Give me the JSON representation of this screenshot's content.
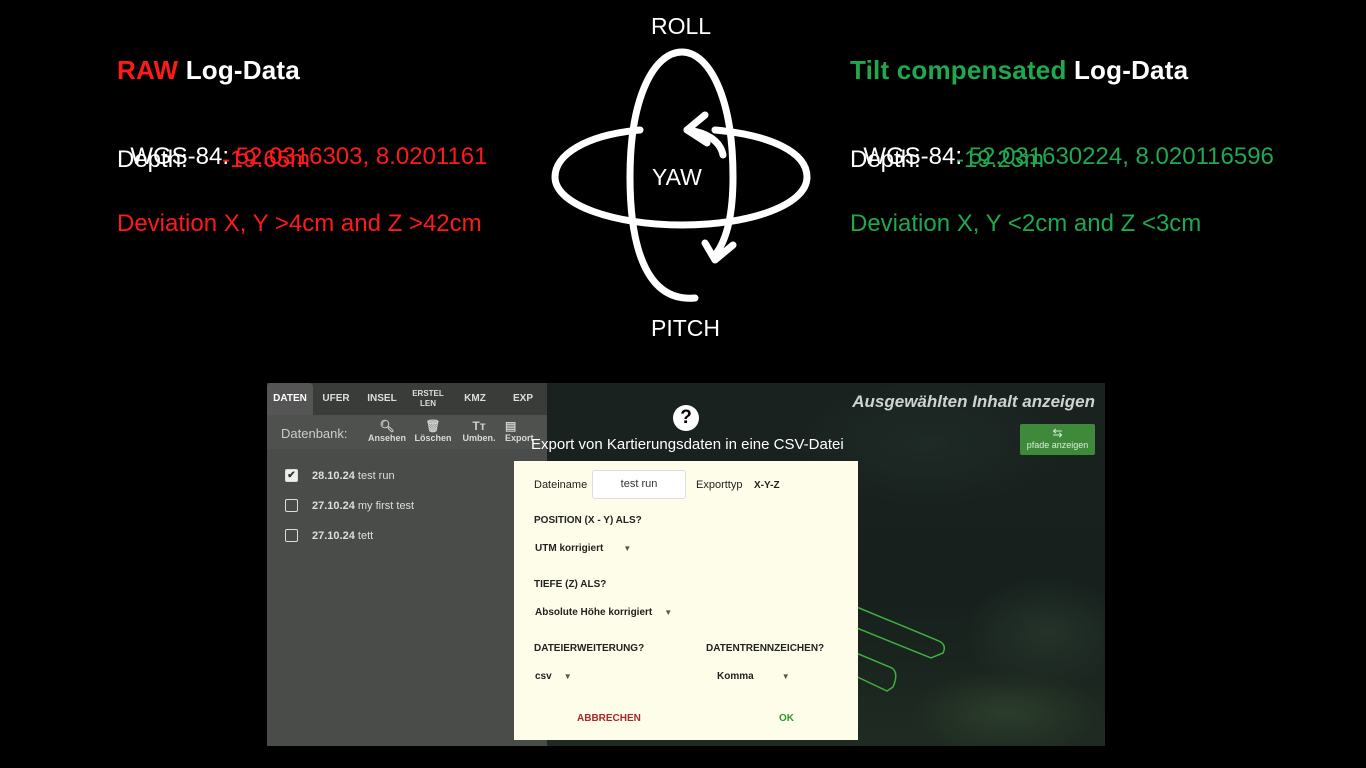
{
  "raw": {
    "heading_accent": "RAW",
    "heading_rest": " Log-Data",
    "wgs_label": "WGS-84: ",
    "wgs_value": "52.0316303, 8.0201161",
    "depth_label": "Depth:",
    "depth_value": "-19.65m",
    "deviation": "Deviation X, Y >4cm and Z >42cm"
  },
  "tilt": {
    "heading_accent": "Tilt compensated",
    "heading_rest": " Log-Data",
    "wgs_label": "WGS-84: ",
    "wgs_value": "52.031630224, 8.020116596",
    "depth_label": "Depth:",
    "depth_value": "-19.23m",
    "deviation": "Deviation X, Y <2cm and Z <3cm"
  },
  "axes": {
    "roll": "ROLL",
    "yaw": "YAW",
    "pitch": "PITCH"
  },
  "app": {
    "tabs": [
      {
        "label": "DATEN"
      },
      {
        "label": "UFER"
      },
      {
        "label": "INSEL"
      },
      {
        "label": "ERSTEL LEN"
      },
      {
        "label": "KMZ"
      },
      {
        "label": "EXP"
      }
    ],
    "toolbar": {
      "label": "Datenbank:",
      "view": "Ansehen",
      "delete": "Löschen",
      "rename": "Umben.",
      "export": "Export"
    },
    "rows": [
      {
        "date": "28.10.24",
        "name": "test run",
        "checked": true
      },
      {
        "date": "27.10.24",
        "name": "my first test",
        "checked": false
      },
      {
        "date": "27.10.24",
        "name": "tett",
        "checked": false
      }
    ],
    "map_title": "Ausgewählten Inhalt anzeigen",
    "pfade_button": "pfade anzeigen"
  },
  "dialog": {
    "help": "?",
    "title": "Export von Kartierungsdaten in eine CSV-Datei",
    "filename_label": "Dateiname",
    "filename_value": "test run",
    "exporttype_label": "Exporttyp",
    "exporttype_value": "X-Y-Z",
    "position_label": "POSITION (X - Y) ALS?",
    "position_value": "UTM korrigiert",
    "depth_label": "TIEFE (Z) ALS?",
    "depth_value": "Absolute Höhe korrigiert",
    "extension_label": "DATEIERWEITERUNG?",
    "extension_value": "csv",
    "separator_label": "DATENTRENNZEICHEN?",
    "separator_value": "Komma",
    "cancel": "ABBRECHEN",
    "ok": "OK"
  },
  "colors": {
    "raw": "#ff1a1a",
    "tilt": "#1fa84f",
    "ok": "#2e9a2e",
    "cancel": "#a52a2a"
  }
}
